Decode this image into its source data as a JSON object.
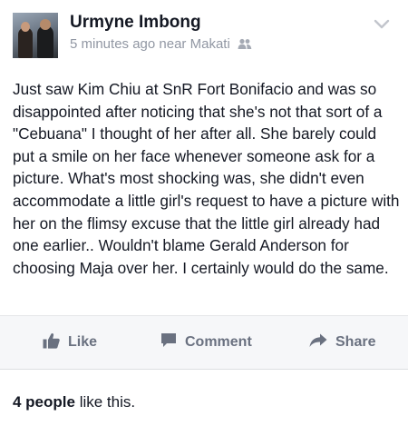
{
  "post": {
    "author": "Urmyne Imbong",
    "time": "5 minutes ago",
    "location_prefix": "near",
    "location": "Makati",
    "audience_icon": "friends-icon",
    "menu_icon": "chevron-down-icon",
    "text": "Just saw Kim Chiu at SnR Fort Bonifacio and was so disappointed after noticing that she's not that sort of a \"Cebuana\" I thought of her after all. She barely could put a smile on her face whenever someone ask for a picture. What's most shocking was, she didn't even accommodate a little girl's request to have a picture with her on the flimsy excuse that the little girl already had one earlier.. Wouldn't blame Gerald Anderson for choosing Maja over her. I certainly would do the same."
  },
  "actions": {
    "like": {
      "label": "Like",
      "icon": "thumbs-up-icon"
    },
    "comment": {
      "label": "Comment",
      "icon": "comment-icon"
    },
    "share": {
      "label": "Share",
      "icon": "share-arrow-icon"
    }
  },
  "likes": {
    "count": "4 people",
    "suffix": " like this."
  },
  "colors": {
    "text": "#141823",
    "meta": "#9197a3",
    "action": "#6a7180",
    "action_bar_bg": "#f6f7f9"
  }
}
